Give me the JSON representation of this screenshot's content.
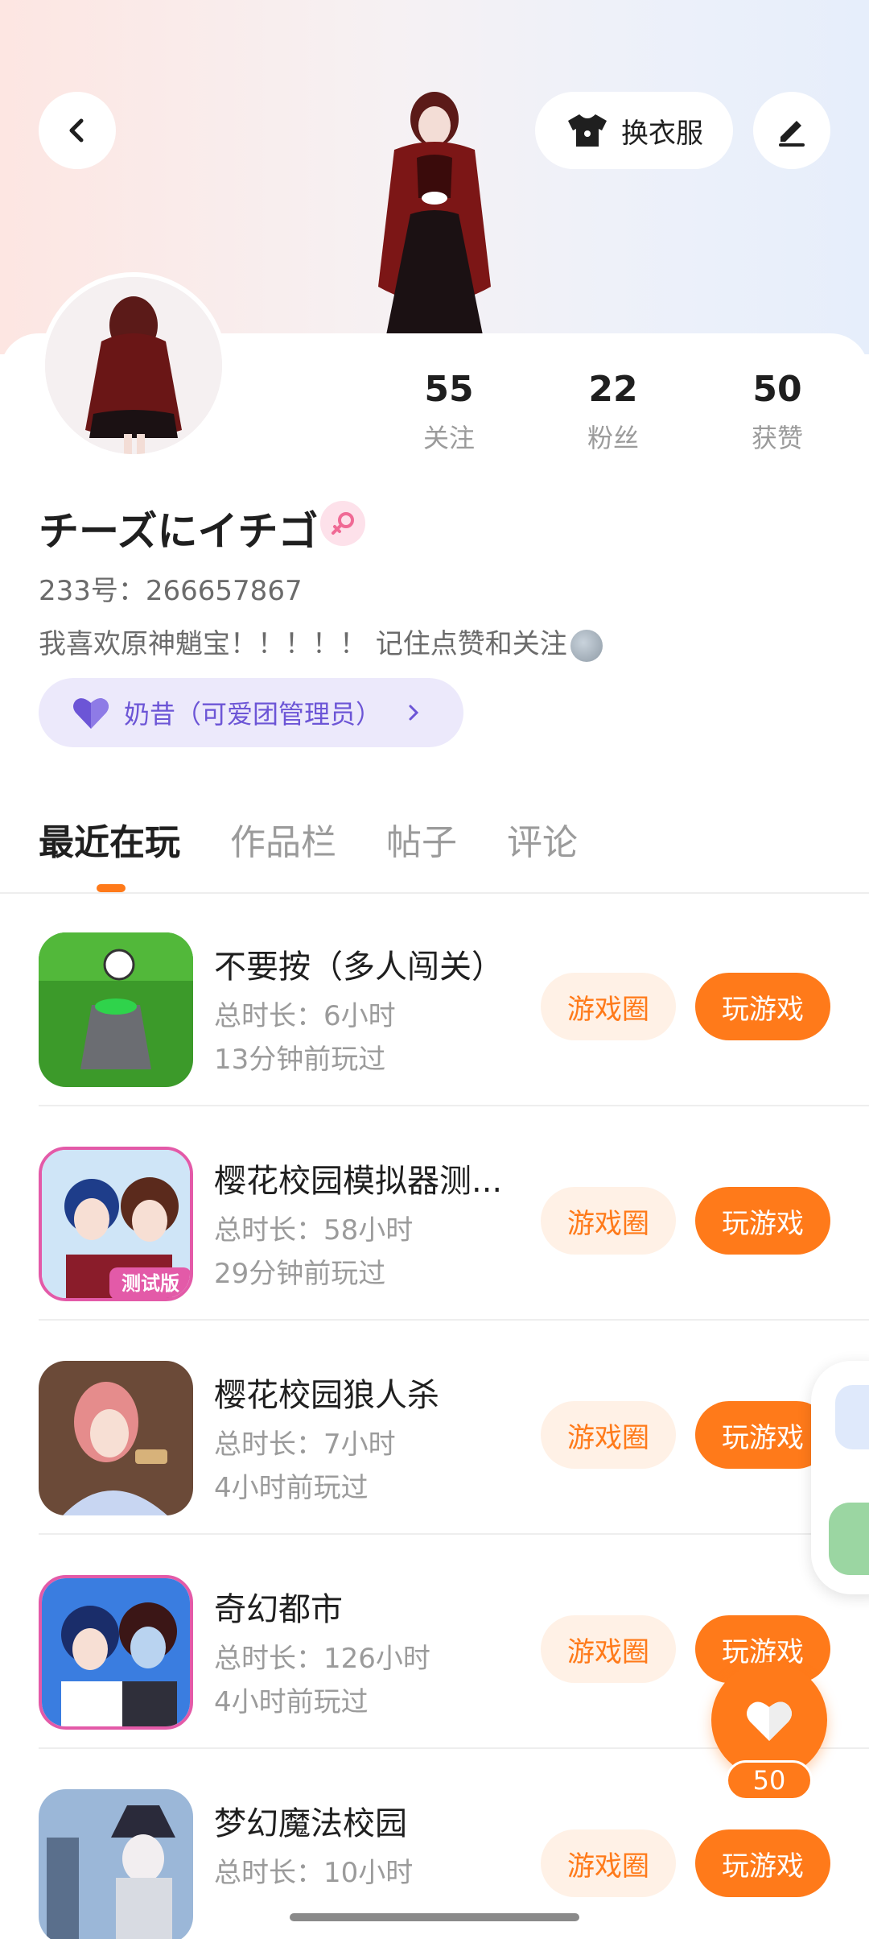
{
  "header": {
    "back_icon": "chevron-left-icon",
    "outfit_button_label": "换衣服",
    "outfit_icon": "shirt-icon",
    "edit_icon": "pencil-icon"
  },
  "profile": {
    "stats": [
      {
        "value": "55",
        "label": "关注"
      },
      {
        "value": "22",
        "label": "粉丝"
      },
      {
        "value": "50",
        "label": "获赞"
      }
    ],
    "username": "チーズにイチゴ",
    "gender_icon": "female-icon",
    "id_line": "233号：266657867",
    "bio": "我喜欢原神魈宝！！！！！ 记住点赞和关注",
    "badge_label": "奶昔（可爱团管理员）",
    "badge_icon": "heart-icon",
    "badge_chevron": "›"
  },
  "tabs": [
    "最近在玩",
    "作品栏",
    "帖子",
    "评论"
  ],
  "games": [
    {
      "title": "不要按（多人闯关）",
      "duration": "总时长：6小时",
      "last_played": "13分钟前玩过",
      "circle_label": "游戏圈",
      "play_label": "玩游戏"
    },
    {
      "title": "樱花校园模拟器测...",
      "duration": "总时长：58小时",
      "last_played": "29分钟前玩过",
      "circle_label": "游戏圈",
      "play_label": "玩游戏",
      "icon_text": "测试版"
    },
    {
      "title": "樱花校园狼人杀",
      "duration": "总时长：7小时",
      "last_played": "4小时前玩过",
      "circle_label": "游戏圈",
      "play_label": "玩游戏"
    },
    {
      "title": "奇幻都市",
      "duration": "总时长：126小时",
      "last_played": "4小时前玩过",
      "circle_label": "游戏圈",
      "play_label": "玩游戏"
    },
    {
      "title": "梦幻魔法校园",
      "duration": "总时长：10小时",
      "last_played": "",
      "circle_label": "游戏圈",
      "play_label": "玩游戏"
    }
  ],
  "like_fab": {
    "count": "50",
    "icon": "heart-icon"
  },
  "colors": {
    "accent": "#ff7a1a",
    "badge_bg": "#ece9fb",
    "badge_text": "#6c55d6"
  }
}
